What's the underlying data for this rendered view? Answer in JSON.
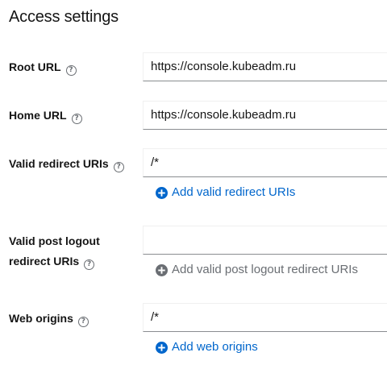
{
  "section": {
    "title": "Access settings"
  },
  "fields": {
    "root_url": {
      "label": "Root URL",
      "value": "https://console.kubeadm.ru",
      "help_icon": "question-circle-icon"
    },
    "home_url": {
      "label": "Home URL",
      "value": "https://console.kubeadm.ru",
      "help_icon": "question-circle-icon"
    },
    "valid_redirect_uris": {
      "label": "Valid redirect URIs",
      "value": "/*",
      "add_label": "Add valid redirect URIs",
      "add_enabled": true,
      "help_icon": "question-circle-icon"
    },
    "valid_post_logout_redirect_uris": {
      "label_line1": "Valid post logout",
      "label_line2": "redirect URIs",
      "value": "",
      "add_label": "Add valid post logout redirect URIs",
      "add_enabled": false,
      "help_icon": "question-circle-icon"
    },
    "web_origins": {
      "label": "Web origins",
      "value": "/*",
      "add_label": "Add web origins",
      "add_enabled": true,
      "help_icon": "question-circle-icon"
    }
  },
  "colors": {
    "link": "#0066cc",
    "disabled": "#6a6e73",
    "input_border_bottom": "#8a8d90",
    "text": "#151515"
  }
}
